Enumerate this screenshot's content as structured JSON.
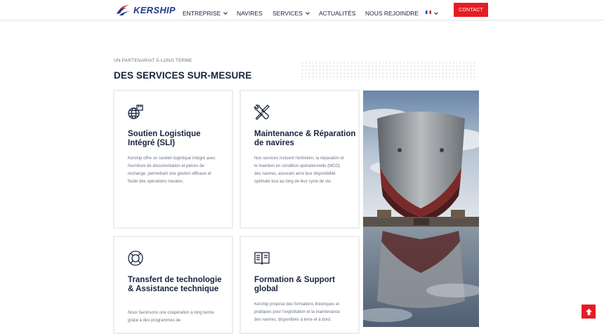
{
  "brand": {
    "name": "KERSHIP"
  },
  "nav": {
    "items": [
      {
        "label": "ENTREPRISE",
        "has_dropdown": true
      },
      {
        "label": "NAVIRES",
        "has_dropdown": false
      },
      {
        "label": "SERVICES",
        "has_dropdown": true
      },
      {
        "label": "ACTUALITÉS",
        "has_dropdown": false
      },
      {
        "label": "NOUS REJOINDRE",
        "has_dropdown": false
      }
    ],
    "language": {
      "icon": "french-flag-icon",
      "has_dropdown": true
    },
    "contact_label": "CONTACT"
  },
  "section": {
    "eyebrow": "UN PARTENARIAT À LONG TERME",
    "title": "DES SERVICES SUR-MESURE"
  },
  "cards": [
    {
      "icon": "globe-box-icon",
      "title": "Soutien Logistique Intégré (SLI)",
      "text": "Kership offre un soutien logistique intégré avec fourniture de documentation et pièces de rechange, permettant une gestion efficace et fluide des opérations navales."
    },
    {
      "icon": "wrench-screwdriver-icon",
      "title": "Maintenance & Réparation de navires",
      "text": "Nos services incluent l'entretien, la réparation et le maintien en condition opérationnelle (MCO) des navires, assurant ainsi leur disponibilité optimale tout au long de leur cycle de vie."
    },
    {
      "icon": "lifebuoy-icon",
      "title": "Transfert de technologie & Assistance technique",
      "text": "Nous favorisons une coopération à long terme grâce à des programmes de"
    },
    {
      "icon": "book-icon",
      "title": "Formation & Support global",
      "text": "Kership propose des formations théoriques et pratiques pour l'exploitation et la maintenance des navires, disponibles à terre et à bord."
    }
  ],
  "colors": {
    "accent": "#e51c24",
    "navy": "#1a2340",
    "muted": "#6b7385"
  }
}
